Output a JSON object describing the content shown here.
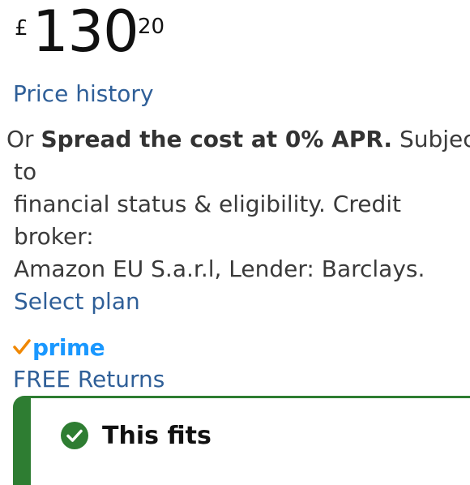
{
  "price": {
    "currency_symbol": "£",
    "whole": "130",
    "fraction": "20"
  },
  "links": {
    "price_history": "Price history",
    "select_plan": "Select plan",
    "free_returns": "FREE Returns"
  },
  "financing": {
    "prefix": "Or ",
    "highlight": "Spread the cost at 0% APR.",
    "line1_suffix": " Subject",
    "line2": "to",
    "line3": "financial status & eligibility. Credit",
    "line4": "broker:",
    "line5": "Amazon EU S.a.r.l, Lender: Barclays."
  },
  "prime": {
    "label": "prime",
    "check_color": "#f08804",
    "text_color": "#1a98ff"
  },
  "fit": {
    "label": "This fits",
    "accent_color": "#2e7d32",
    "icon": "check-circle-icon"
  }
}
